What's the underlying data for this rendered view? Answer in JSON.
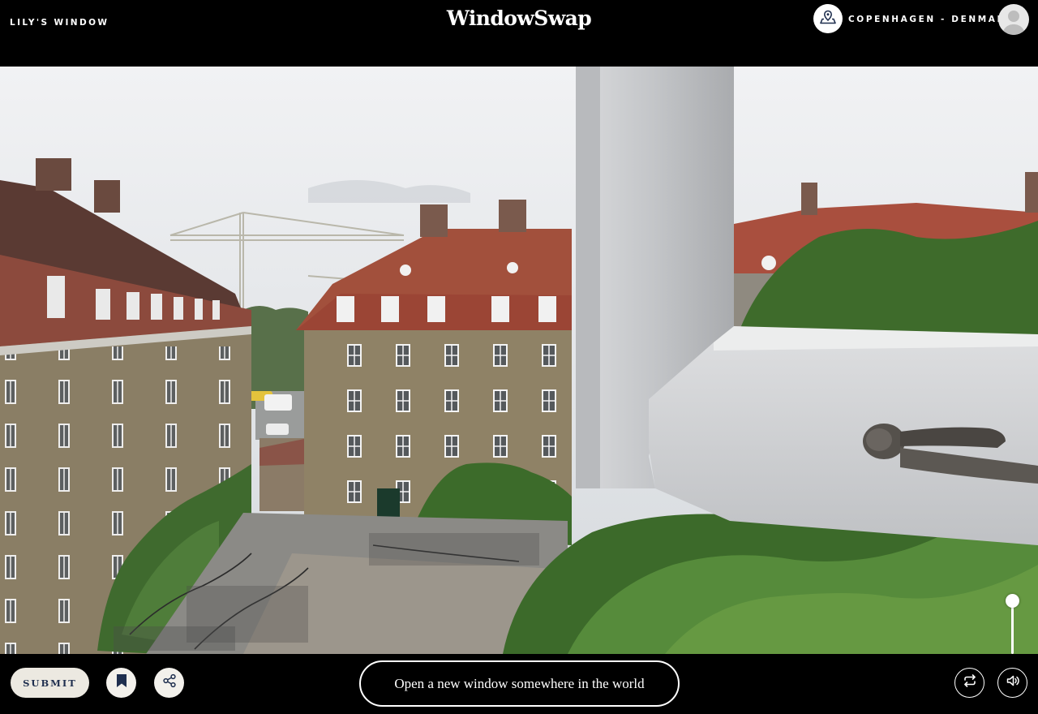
{
  "header": {
    "window_name": "LILY'S WINDOW",
    "brand": "WindowSwap",
    "location": "COPENHAGEN - DENMARK",
    "location_icon": "map-pin-icon",
    "avatar_icon": "user-avatar-icon"
  },
  "video": {
    "scene": "window-view",
    "volume_level": 1.0
  },
  "footer": {
    "submit_label": "SUBMIT",
    "bookmark_icon": "bookmark-icon",
    "share_icon": "share-icon",
    "new_window_label": "Open a new window somewhere in the world",
    "swap_icon": "repeat-icon",
    "sound_icon": "speaker-icon"
  },
  "colors": {
    "background": "#000000",
    "button_light": "#ece9e1",
    "submit_text": "#1f2f4f",
    "bookmark": "#1f2f4f"
  }
}
